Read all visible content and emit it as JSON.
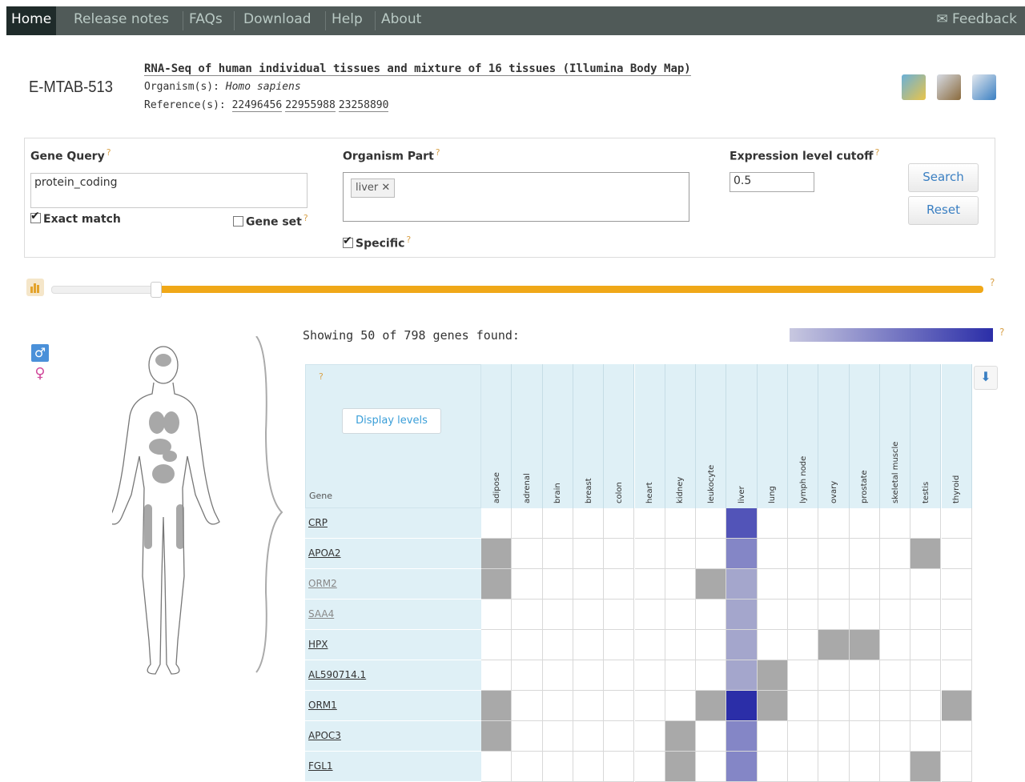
{
  "nav": {
    "items": [
      "Home",
      "Release notes",
      "FAQs",
      "Download",
      "Help",
      "About"
    ],
    "feedback": "Feedback"
  },
  "experiment": {
    "accession": "E-MTAB-513",
    "title": "RNA-Seq of human individual tissues and mixture of 16 tissues (Illumina Body Map)",
    "organism_label": "Organism(s):",
    "organism_value": "Homo sapiens",
    "reference_label": "Reference(s):",
    "references": [
      "22496456",
      "22955988",
      "23258890"
    ]
  },
  "query": {
    "gene_query_label": "Gene Query",
    "gene_query_value": "protein_coding",
    "exact_match_label": "Exact match",
    "exact_match_checked": true,
    "gene_set_label": "Gene set",
    "gene_set_checked": false,
    "organism_part_label": "Organism Part",
    "organism_part_tag": "liver",
    "specific_label": "Specific",
    "specific_checked": true,
    "cutoff_label": "Expression level cutoff",
    "cutoff_value": "0.5",
    "search_label": "Search",
    "reset_label": "Reset",
    "help_mark": "?"
  },
  "heatmap": {
    "showing_text": "Showing 50 of 798 genes found:",
    "display_levels_label": "Display levels",
    "gene_header": "Gene",
    "help_mark": "?",
    "tissues": [
      "adipose",
      "adrenal",
      "brain",
      "breast",
      "colon",
      "heart",
      "kidney",
      "leukocyte",
      "liver",
      "lung",
      "lymph node",
      "ovary",
      "prostate",
      "skeletal muscle",
      "testis",
      "thyroid"
    ],
    "genes": [
      {
        "name": "CRP",
        "light": false
      },
      {
        "name": "APOA2",
        "light": false
      },
      {
        "name": "ORM2",
        "light": true
      },
      {
        "name": "SAA4",
        "light": true
      },
      {
        "name": "HPX",
        "light": false
      },
      {
        "name": "AL590714.1",
        "light": false
      },
      {
        "name": "ORM1",
        "light": false
      },
      {
        "name": "APOC3",
        "light": false
      },
      {
        "name": "FGL1",
        "light": false
      }
    ],
    "cells": [
      [
        "",
        "",
        "",
        "",
        "",
        "",
        "",
        "",
        "b1",
        "",
        "",
        "",
        "",
        "",
        "",
        ""
      ],
      [
        "g",
        "",
        "",
        "",
        "",
        "",
        "",
        "",
        "b2",
        "",
        "",
        "",
        "",
        "",
        "g",
        ""
      ],
      [
        "g",
        "",
        "",
        "",
        "",
        "",
        "",
        "g",
        "b3",
        "",
        "",
        "",
        "",
        "",
        "",
        ""
      ],
      [
        "",
        "",
        "",
        "",
        "",
        "",
        "",
        "",
        "b3",
        "",
        "",
        "",
        "",
        "",
        "",
        ""
      ],
      [
        "",
        "",
        "",
        "",
        "",
        "",
        "",
        "",
        "b3",
        "",
        "",
        "g",
        "g",
        "",
        "",
        ""
      ],
      [
        "",
        "",
        "",
        "",
        "",
        "",
        "",
        "",
        "b3",
        "g",
        "",
        "",
        "",
        "",
        "",
        ""
      ],
      [
        "g",
        "",
        "",
        "",
        "",
        "",
        "",
        "g",
        "b0",
        "g",
        "",
        "",
        "",
        "",
        "",
        "g"
      ],
      [
        "g",
        "",
        "",
        "",
        "",
        "",
        "g",
        "",
        "b2",
        "",
        "",
        "",
        "",
        "",
        "",
        ""
      ],
      [
        "",
        "",
        "",
        "",
        "",
        "",
        "g",
        "",
        "b2",
        "",
        "",
        "",
        "",
        "",
        "g",
        ""
      ]
    ],
    "colors": {
      "g": "#a9a9a9",
      "b0": "#2b2ea8",
      "b1": "#5254b8",
      "b2": "#8486c6",
      "b3": "#a4a6cc"
    }
  },
  "icons": {
    "download_arrow": "download-icon",
    "male": "male-icon",
    "female": "female-icon"
  }
}
